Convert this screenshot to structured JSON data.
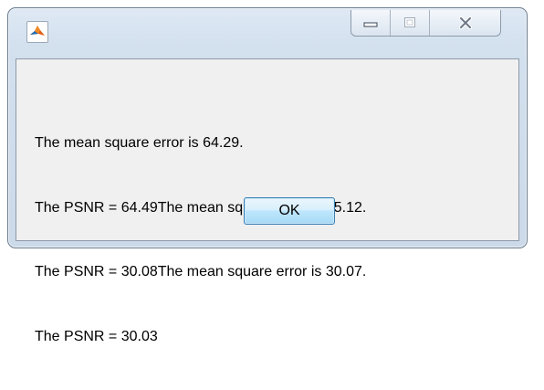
{
  "window": {
    "title": "",
    "app_icon": "matlab-icon"
  },
  "caption_buttons": {
    "minimize_icon": "minimize-icon",
    "maximize_icon": "maximize-icon",
    "close_icon": "close-icon"
  },
  "message": {
    "lines": [
      "The mean square error is 64.29.",
      "The PSNR = 64.49The mean square error is 65.12.",
      "The PSNR = 30.08The mean square error is 30.07.",
      "The PSNR = 30.03"
    ]
  },
  "ok_button": {
    "label": "OK"
  },
  "colors": {
    "accent": "#3c7fb1",
    "frame": "#cbd9e9",
    "client": "#f0f0f0"
  }
}
